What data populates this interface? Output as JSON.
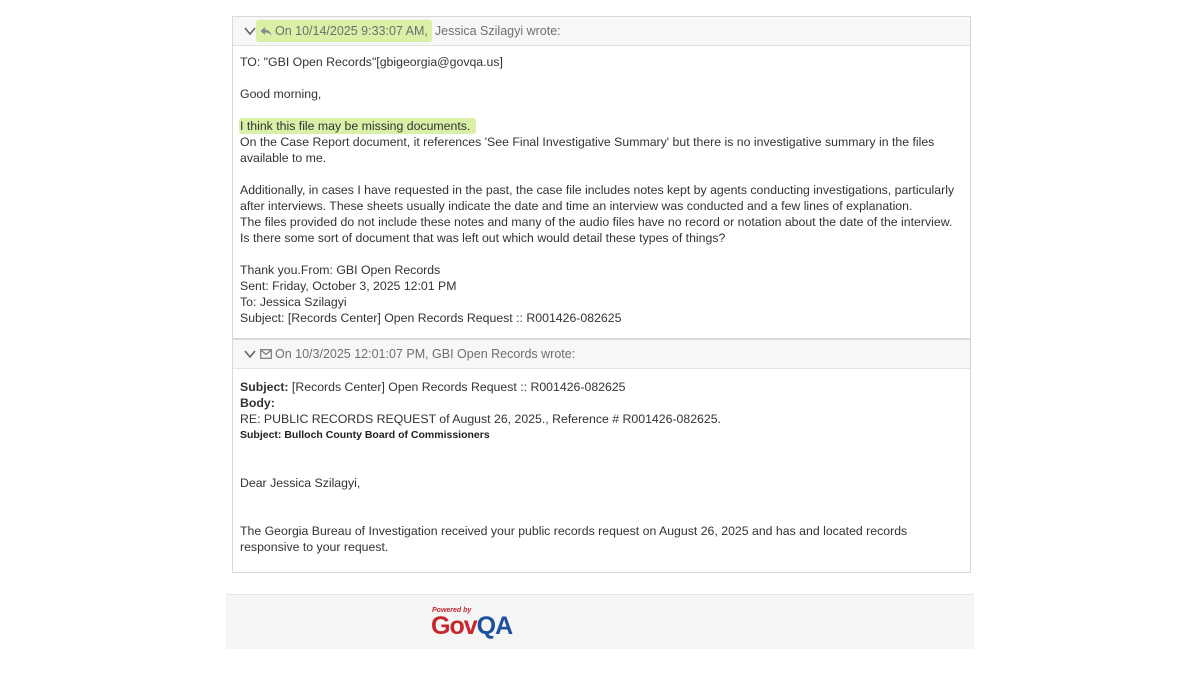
{
  "messages": [
    {
      "header": {
        "timestamp_text": "On 10/14/2025 9:33:07 AM,",
        "author_text": "Jessica Szilagyi wrote:",
        "icon": "reply-icon"
      },
      "body": {
        "to_line": "TO: \"GBI Open Records\"[gbigeorgia@govqa.us]",
        "greeting": "Good morning,",
        "highlight_line": "I think this file may be missing documents.",
        "p1": "On the Case Report document, it references 'See Final Investigative Summary' but there is no investigative summary in the files available to me.",
        "p2": "Additionally, in cases I have requested in the past, the case file includes notes kept by agents conducting investigations, particularly after interviews. These sheets usually indicate the date and time an interview was conducted and a few lines of explanation.",
        "p3": "The files provided do not include these notes and many of the audio files have no record or notation about the date of the interview. Is there some sort of document that was left out which would detail these types of things?",
        "thanks_from": "Thank you.From: GBI Open Records",
        "sent": "Sent: Friday, October 3, 2025 12:01 PM",
        "to": "To: Jessica Szilagyi",
        "subject": "Subject: [Records Center] Open Records Request :: R001426-082625"
      }
    },
    {
      "header": {
        "text": "On 10/3/2025 12:01:07 PM, GBI Open Records wrote:",
        "icon": "envelope-icon"
      },
      "body": {
        "subject_label": "Subject:",
        "subject_value": " [Records Center] Open Records Request :: R001426-082625",
        "body_label": "Body:",
        "re_line": "RE: PUBLIC RECORDS REQUEST of August 26, 2025., Reference # R001426-082625.",
        "small_subject": "Subject: Bulloch County Board of Commissioners",
        "dear": "Dear Jessica Szilagyi,",
        "paragraph": "The Georgia Bureau of Investigation received your public records request on August 26, 2025 and has and located records responsive to your request."
      }
    }
  ],
  "footer": {
    "powered_by": "Powered by",
    "logo_gov": "Gov",
    "logo_qa": "QA"
  },
  "colors": {
    "highlight": "#d9f0a6",
    "logo_red": "#c7252b",
    "logo_blue": "#1c4f9c"
  }
}
